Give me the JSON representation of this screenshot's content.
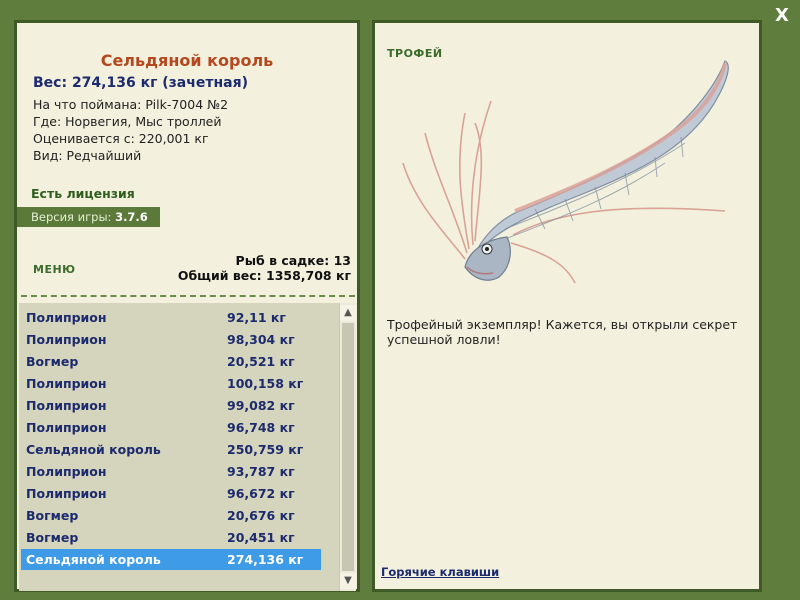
{
  "window": {
    "close_label": "X"
  },
  "fish": {
    "title": "Сельдяной король",
    "weight": "Вес: 274,136 кг (зачетная)",
    "caught_with": "На что поймана: Pilk-7004 №2",
    "location": "Где: Норвегия, Мыс троллей",
    "valued_from": "Оценивается с: 220,001 кг",
    "rarity": "Вид: Редчайший"
  },
  "license": "Есть лицензия",
  "version": {
    "label": "Версия игры:",
    "value": "3.7.6"
  },
  "menu_label": "МЕНЮ",
  "stats": {
    "fish_in_keepnet": "Рыб в садке: 13",
    "total_weight": "Общий вес: 1358,708 кг"
  },
  "catch_list": [
    {
      "name": "Полиприон",
      "weight": "92,11 кг"
    },
    {
      "name": "Полиприон",
      "weight": "98,304 кг"
    },
    {
      "name": "Вогмер",
      "weight": "20,521 кг"
    },
    {
      "name": "Полиприон",
      "weight": "100,158 кг"
    },
    {
      "name": "Полиприон",
      "weight": "99,082 кг"
    },
    {
      "name": "Полиприон",
      "weight": "96,748 кг"
    },
    {
      "name": "Сельдяной король",
      "weight": "250,759 кг"
    },
    {
      "name": "Полиприон",
      "weight": "93,787 кг"
    },
    {
      "name": "Полиприон",
      "weight": "96,672 кг"
    },
    {
      "name": "Вогмер",
      "weight": "20,676 кг"
    },
    {
      "name": "Вогмер",
      "weight": "20,451 кг"
    },
    {
      "name": "Сельдяной король",
      "weight": "274,136 кг"
    }
  ],
  "selected_index": 11,
  "trophy": {
    "label": "ТРОФЕЙ",
    "text": "Трофейный экземпляр! Кажется, вы открыли секрет успешной ловли!"
  },
  "hotkeys_label": "Горячие клавиши",
  "icons": {
    "scroll_up": "▲",
    "scroll_down": "▼"
  },
  "colors": {
    "background": "#5f7d3c",
    "panel": "#f3f1de",
    "title": "#b5481e",
    "accent_text": "#1c2a6e",
    "selected_row": "#3d9be8"
  }
}
